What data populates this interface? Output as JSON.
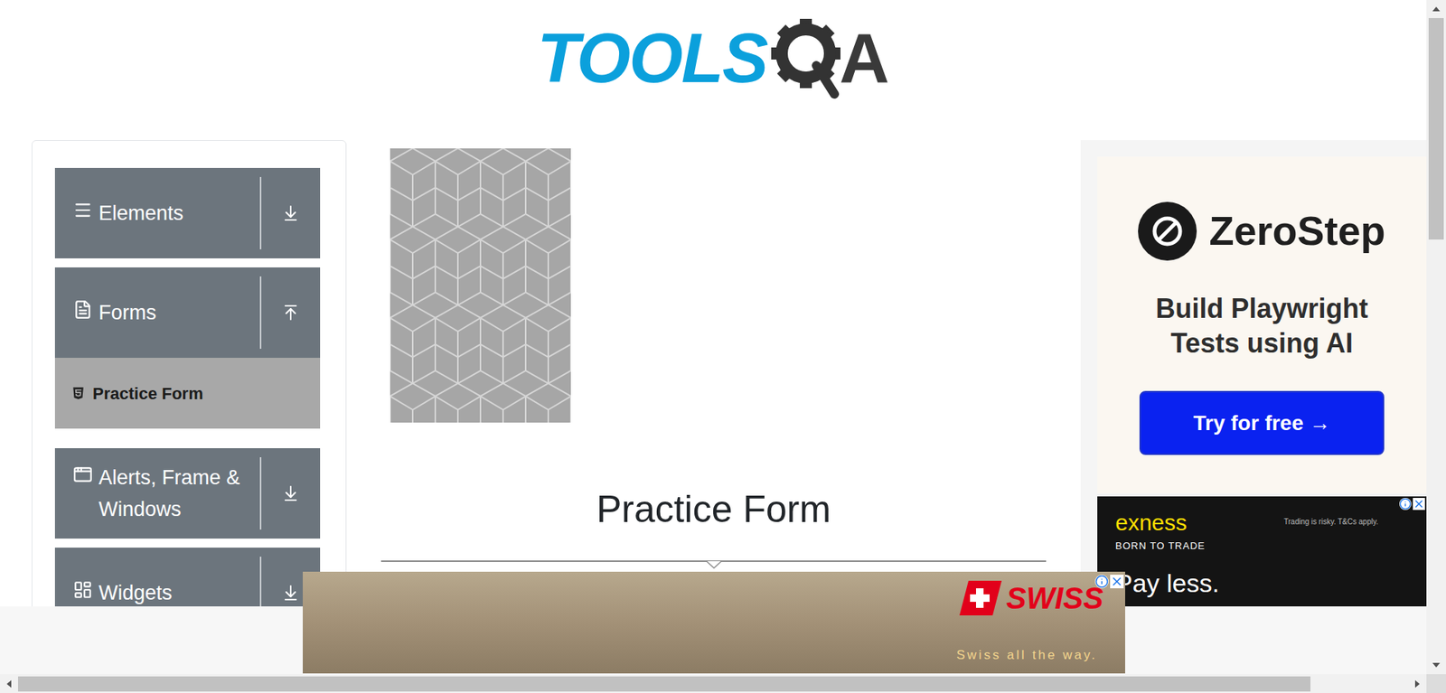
{
  "logo": {
    "left": "TOOLS",
    "right": "A"
  },
  "sidebar": {
    "items": [
      {
        "label": "Elements",
        "kind": "group",
        "expanded": false,
        "selected": false
      },
      {
        "label": "Forms",
        "kind": "group",
        "expanded": true,
        "selected": false
      },
      {
        "label": "Practice Form",
        "kind": "item",
        "expanded": false,
        "selected": true
      },
      {
        "label": "Alerts, Frame & Windows",
        "kind": "group",
        "expanded": false,
        "selected": false
      },
      {
        "label": "Widgets",
        "kind": "group",
        "expanded": false,
        "selected": false
      }
    ]
  },
  "page": {
    "heading": "Practice Form"
  },
  "ads": {
    "zerostep": {
      "brand": "ZeroStep",
      "tagline": "Build Playwright Tests using AI",
      "button": "Try for free →"
    },
    "exness": {
      "brand": "exness",
      "slogan": "BORN TO TRADE",
      "disclaimer": "Trading is risky. T&Cs apply.",
      "headline": "Pay less."
    },
    "swiss": {
      "brand": "SWISS",
      "slogan": "Swiss all the way."
    }
  }
}
